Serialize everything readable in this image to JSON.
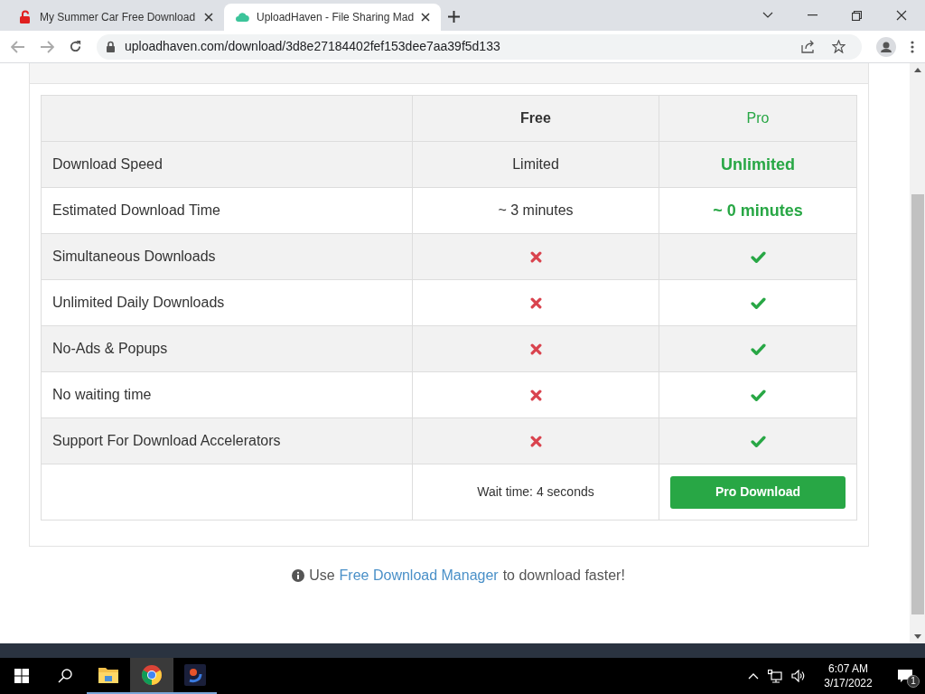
{
  "tabs": [
    {
      "title": "My Summer Car Free Download",
      "selected": false
    },
    {
      "title": "UploadHaven - File Sharing Mad",
      "selected": true
    }
  ],
  "address_bar": {
    "url": "uploadhaven.com/download/3d8e27184402fef153dee7aa39f5d133"
  },
  "table": {
    "columns": [
      "",
      "Free",
      "Pro"
    ],
    "rows": [
      {
        "kind": "text",
        "feature": "Download Speed",
        "free": "Limited",
        "pro": "Unlimited"
      },
      {
        "kind": "text",
        "feature": "Estimated Download Time",
        "free": "~ 3 minutes",
        "pro": "~ 0 minutes"
      },
      {
        "kind": "check",
        "feature": "Simultaneous Downloads",
        "free_included": false,
        "pro_included": true
      },
      {
        "kind": "check",
        "feature": "Unlimited Daily Downloads",
        "free_included": false,
        "pro_included": true
      },
      {
        "kind": "check",
        "feature": "No-Ads & Popups",
        "free_included": false,
        "pro_included": true
      },
      {
        "kind": "check",
        "feature": "No waiting time",
        "free_included": false,
        "pro_included": true
      },
      {
        "kind": "check",
        "feature": "Support For Download Accelerators",
        "free_included": false,
        "pro_included": true
      }
    ],
    "wait_time": "Wait time: 4 seconds",
    "pro_button": "Pro Download"
  },
  "note": {
    "before": "Use",
    "link": "Free Download Manager",
    "after": "to download faster!"
  },
  "taskbar": {
    "apps": [
      {
        "kind": "folder",
        "selected": false
      },
      {
        "kind": "chrome",
        "selected": true
      },
      {
        "kind": "app",
        "selected": false
      }
    ],
    "time": "6:07 AM",
    "date": "3/17/2022",
    "notifications": "1"
  }
}
